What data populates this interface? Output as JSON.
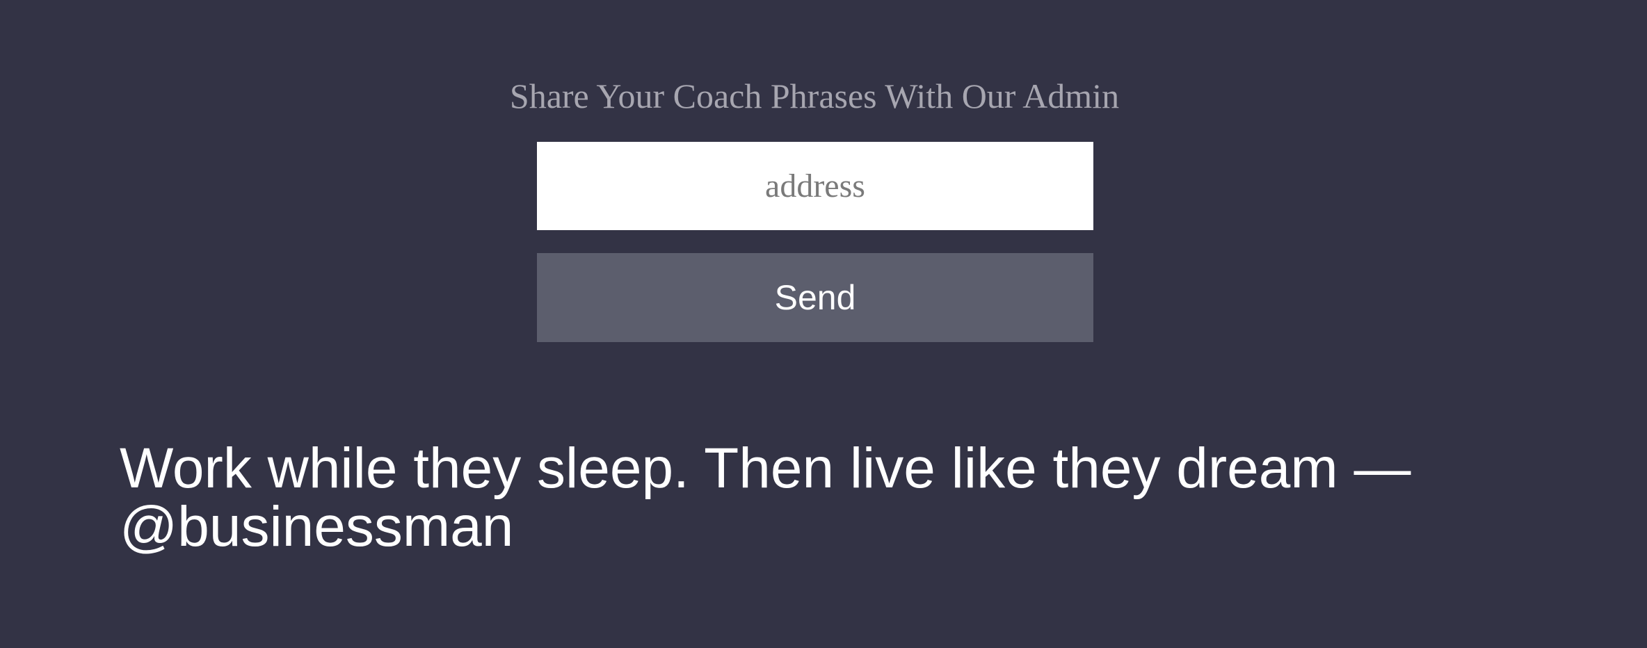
{
  "form": {
    "heading": "Share Your Coach Phrases With Our Admin",
    "address_placeholder": "address",
    "address_value": "",
    "send_label": "Send"
  },
  "quote": {
    "text": "Work while they sleep. Then live like they dream — @businessman"
  },
  "colors": {
    "background": "#333345",
    "heading_text": "#a7a6b0",
    "input_background": "#ffffff",
    "button_background": "#5c5e6d",
    "quote_text": "#ffffff"
  }
}
